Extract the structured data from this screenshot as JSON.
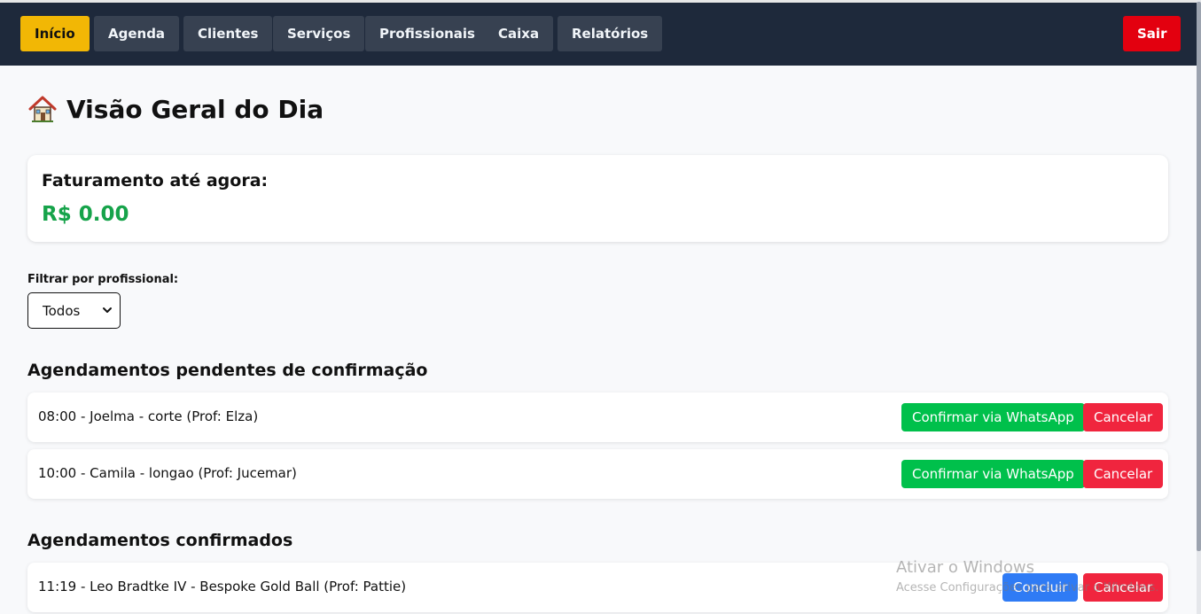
{
  "nav": {
    "items": [
      {
        "label": "Início",
        "active": true
      },
      {
        "label": "Agenda"
      },
      {
        "label": "Clientes"
      },
      {
        "label": "Serviços"
      },
      {
        "label": "Profissionais"
      },
      {
        "label": "Caixa"
      },
      {
        "label": "Relatórios"
      }
    ],
    "logout_label": "Sair"
  },
  "page": {
    "title": "Visão Geral do Dia",
    "title_icon": "house-icon"
  },
  "revenue": {
    "label": "Faturamento até agora:",
    "value": "R$ 0.00"
  },
  "filter": {
    "label": "Filtrar por profissional:",
    "selected": "Todos"
  },
  "pending": {
    "title": "Agendamentos pendentes de confirmação",
    "confirm_label": "Confirmar via WhatsApp",
    "cancel_label": "Cancelar",
    "items": [
      {
        "text": "08:00 - Joelma - corte (Prof: Elza)"
      },
      {
        "text": "10:00 - Camila - longao (Prof: Jucemar)"
      }
    ]
  },
  "confirmed": {
    "title": "Agendamentos confirmados",
    "conclude_label": "Concluir",
    "cancel_label": "Cancelar",
    "items": [
      {
        "text": "11:19 - Leo Bradtke IV - Bespoke Gold Ball (Prof: Pattie)"
      }
    ]
  },
  "watermark": {
    "title": "Ativar o Windows",
    "subtitle": "Acesse Configurações para ativar o Windows."
  },
  "colors": {
    "navbar": "#1e293b",
    "active_tab": "#f2b705",
    "logout": "#e3000f",
    "revenue": "#16a34a",
    "whatsapp": "#00c04b",
    "cancel": "#f0253e",
    "conclude": "#2f7bf5"
  }
}
